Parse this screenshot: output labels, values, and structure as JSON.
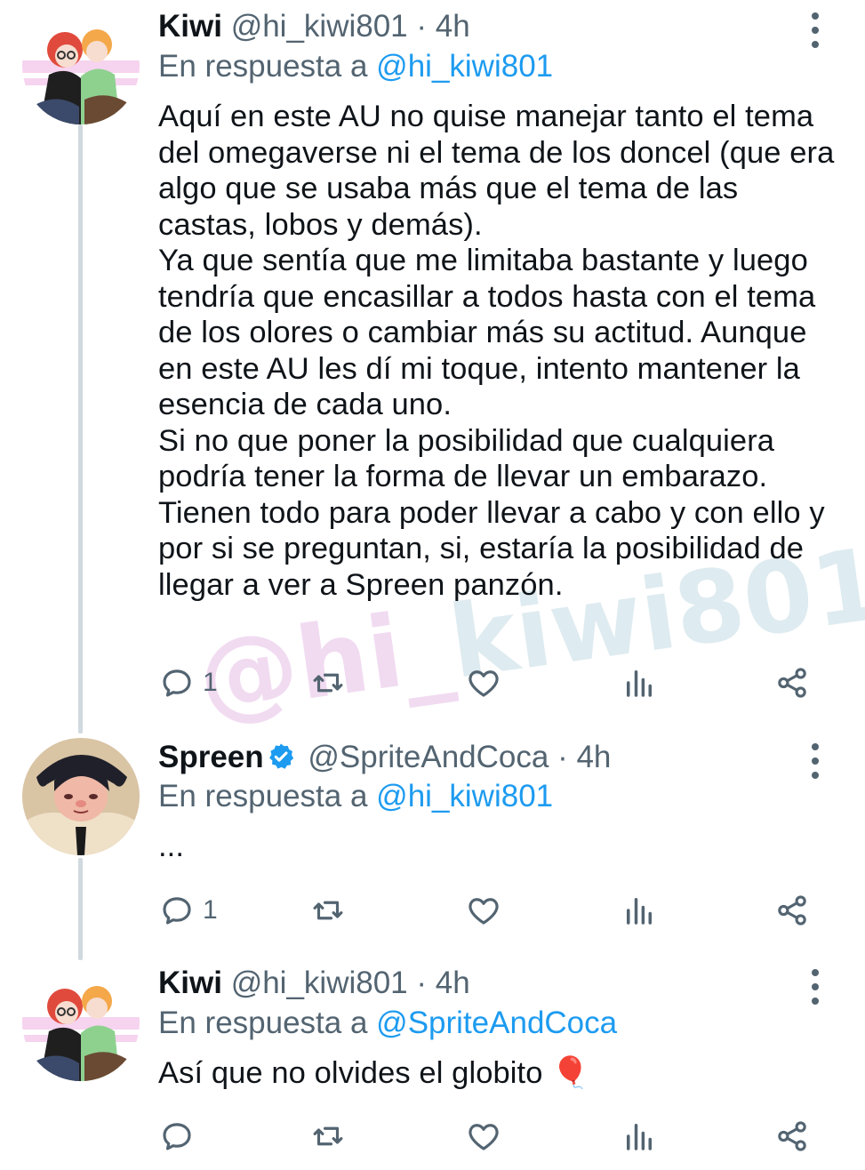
{
  "tweets": [
    {
      "name": "Kiwi",
      "handle": "@hi_kiwi801",
      "dot": "·",
      "time": "4h",
      "reply_prefix": "En respuesta a",
      "reply_mention": "@hi_kiwi801",
      "text": "Aquí en este AU no quise manejar tanto el tema del omegaverse ni el tema de los doncel (que era algo que se usaba más que el tema de las castas, lobos y demás).\nYa que sentía que me limitaba bastante y luego tendría que encasillar a todos hasta con el tema de los olores o cambiar más su actitud. Aunque en este AU les dí mi toque, intento mantener la esencia de cada uno.\nSi no que poner la posibilidad que cualquiera podría tener la forma de llevar un embarazo. Tienen todo para poder llevar a cabo y con ello y por si se preguntan, si, estaría la posibilidad de llegar a ver a Spreen panzón.",
      "reply_count": "1"
    },
    {
      "name": "Spreen",
      "verified": true,
      "handle": "@SpriteAndCoca",
      "dot": "·",
      "time": "4h",
      "reply_prefix": "En respuesta a",
      "reply_mention": "@hi_kiwi801",
      "text": "...",
      "reply_count": "1"
    },
    {
      "name": "Kiwi",
      "handle": "@hi_kiwi801",
      "dot": "·",
      "time": "4h",
      "reply_prefix": "En respuesta a",
      "reply_mention": "@SpriteAndCoca",
      "text": "Así que no olvides el globito 🎈",
      "reply_count": ""
    }
  ],
  "watermark": {
    "lead": "@hi_",
    "tail": "kiwi801"
  },
  "icons": {
    "reply": "reply-icon",
    "retweet": "retweet-icon",
    "like": "like-icon",
    "views": "views-icon",
    "share": "share-icon",
    "more": "more-options-icon",
    "verified": "verified-badge-icon",
    "balloon": "balloon-emoji"
  },
  "colors": {
    "link": "#1d9bf0",
    "secondary_text": "#536471",
    "primary_text": "#0f1419",
    "thread_line": "#cfd9de",
    "verified": "#1d9bf0"
  }
}
